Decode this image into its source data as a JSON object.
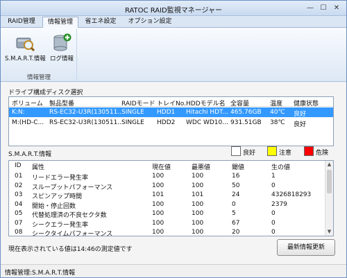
{
  "window": {
    "title": "RATOC RAID監視マネージャー",
    "min_glyph": "—",
    "max_glyph": "☐",
    "close_glyph": "✕"
  },
  "tabs": [
    {
      "label": "RAID管理",
      "active": false
    },
    {
      "label": "情報管理",
      "active": true
    },
    {
      "label": "省エネ設定",
      "active": false
    },
    {
      "label": "オプション設定",
      "active": false
    }
  ],
  "ribbon": {
    "smart_label": "S.M.A.R.T.情報",
    "log_label": "ログ情報",
    "group_label": "情報管理"
  },
  "drive_section": {
    "label": "ドライブ構成ディスク選択",
    "columns": [
      "ボリューム",
      "製品型番",
      "RAIDモード",
      "トレイNo.",
      "HDDモデル名",
      "全容量",
      "温度",
      "健康状態"
    ],
    "rows": [
      {
        "volume": "K:N:",
        "model": "RS-EC32-U3R(130511...",
        "mode": "SINGLE",
        "tray": "HDD1",
        "hdd_model": "Hitachi HDT...",
        "capacity": "465.76GB",
        "temp": "40℃",
        "health": "良好",
        "selected": true
      },
      {
        "volume": "M:(HD-C...",
        "model": "RS-EC32-U3R(130511...",
        "mode": "SINGLE",
        "tray": "HDD2",
        "hdd_model": "WDC WD10...",
        "capacity": "931.51GB",
        "temp": "38℃",
        "health": "良好",
        "selected": false
      }
    ]
  },
  "smart_section": {
    "label": "S.M.A.R.T.情報",
    "legend": [
      {
        "label": "良好",
        "color": "#ffffff"
      },
      {
        "label": "注意",
        "color": "#ffff00"
      },
      {
        "label": "危険",
        "color": "#ff0000"
      }
    ],
    "columns": [
      "ID",
      "属性",
      "現在値",
      "最悪値",
      "閾値",
      "生の値"
    ],
    "rows": [
      {
        "id": "01",
        "attr": "リードエラー発生率",
        "current": "100",
        "worst": "100",
        "threshold": "16",
        "raw": "1"
      },
      {
        "id": "02",
        "attr": "スループットパフォーマンス",
        "current": "100",
        "worst": "100",
        "threshold": "50",
        "raw": "0"
      },
      {
        "id": "03",
        "attr": "スピンアップ時間",
        "current": "101",
        "worst": "101",
        "threshold": "24",
        "raw": "4326818293"
      },
      {
        "id": "04",
        "attr": "開始・停止回数",
        "current": "100",
        "worst": "100",
        "threshold": "0",
        "raw": "2379"
      },
      {
        "id": "05",
        "attr": "代替処理済の不良セクタ数",
        "current": "100",
        "worst": "100",
        "threshold": "5",
        "raw": "0"
      },
      {
        "id": "07",
        "attr": "シークエラー発生率",
        "current": "100",
        "worst": "100",
        "threshold": "67",
        "raw": "0"
      },
      {
        "id": "08",
        "attr": "シークタイムパフォーマンス",
        "current": "100",
        "worst": "100",
        "threshold": "20",
        "raw": "0"
      }
    ]
  },
  "footer": {
    "measure_text": "現在表示されている値は14:46の測定値です",
    "refresh_button": "最新情報更新"
  },
  "statusbar": {
    "text": "情報管理:S.M.A.R.T.情報"
  }
}
